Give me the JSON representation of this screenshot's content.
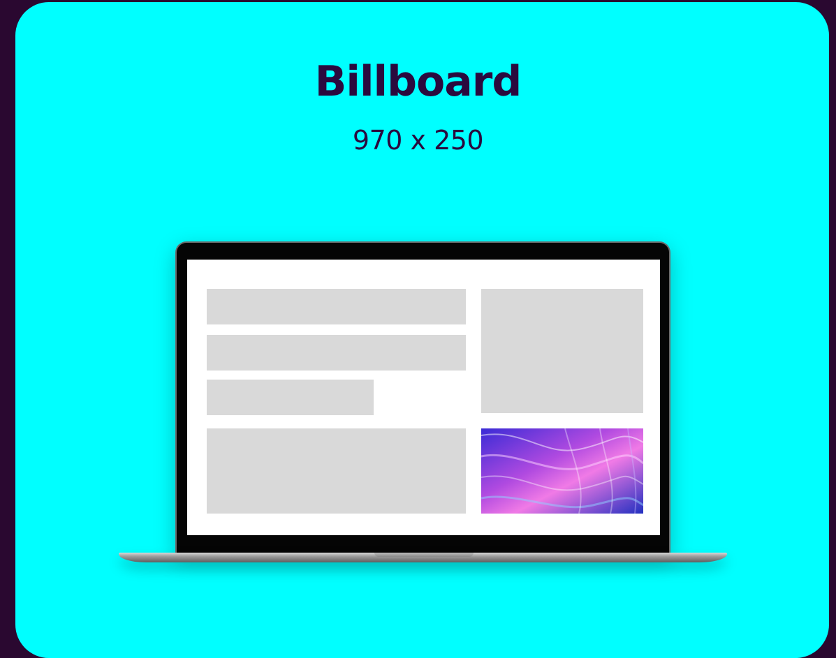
{
  "heading": {
    "title": "Billboard",
    "dimensions": "970 x 250"
  },
  "colors": {
    "page_background": "#2a0830",
    "card_background": "#00ffff",
    "text": "#2a0a3e",
    "placeholder_block": "#d9d9d9"
  },
  "illustration": {
    "device": "laptop-icon",
    "featured_image": "abstract-wave-image"
  }
}
